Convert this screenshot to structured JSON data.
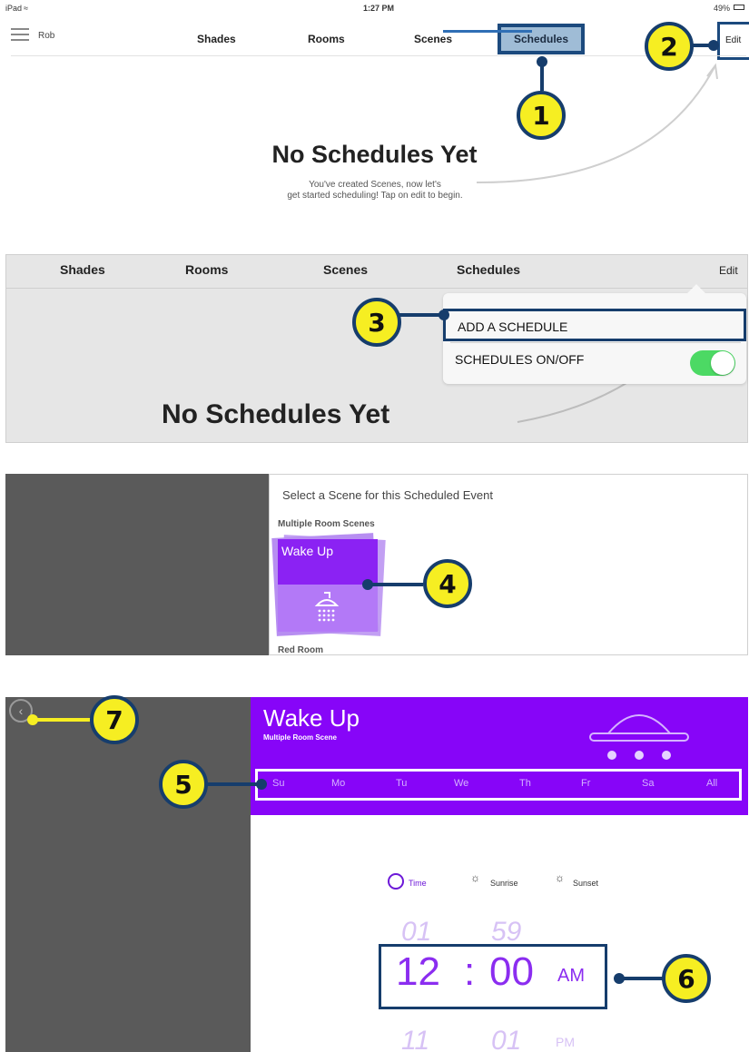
{
  "panel1": {
    "status": {
      "device": "iPad",
      "wifi_icon": "wifi-icon",
      "time": "1:27 PM",
      "battery": "49%"
    },
    "user_name": "Rob",
    "tabs": [
      "Shades",
      "Rooms",
      "Scenes",
      "Schedules"
    ],
    "edit_label": "Edit",
    "empty_title": "No Schedules Yet",
    "empty_subtitle_line1": "You've created Scenes, now let's",
    "empty_subtitle_line2": "get started scheduling! Tap on edit to begin."
  },
  "panel2": {
    "tabs": [
      "Shades",
      "Rooms",
      "Scenes",
      "Schedules"
    ],
    "edit_label": "Edit",
    "menu": {
      "add": "ADD A SCHEDULE",
      "toggle_label": "SCHEDULES ON/OFF",
      "toggle_on": true
    },
    "empty_title": "No Schedules Yet"
  },
  "panel3": {
    "title": "Select a Scene for this Scheduled Event",
    "group_label": "Multiple Room Scenes",
    "scene_name": "Wake Up",
    "scene_icon": "shower-icon",
    "next_group_label": "Red Room"
  },
  "panel4": {
    "scene_name": "Wake Up",
    "scene_type": "Multiple Room Scene",
    "days": [
      "Su",
      "Mo",
      "Tu",
      "We",
      "Th",
      "Fr",
      "Sa",
      "All"
    ],
    "time_display": "12:00 AM",
    "mode_tabs": [
      "Time",
      "Sunrise",
      "Sunset"
    ],
    "picker": {
      "prev_hour": "01",
      "prev_minute": "59",
      "hour": "12",
      "separator": ":",
      "minute": "00",
      "ampm": "AM",
      "next_hour": "11",
      "next_minute": "01",
      "next_ampm": "PM"
    }
  },
  "callouts": [
    "1",
    "2",
    "3",
    "4",
    "5",
    "6",
    "7"
  ],
  "colors": {
    "callout_fill": "#f6ee22",
    "callout_stroke": "#163d6c",
    "purple": "#8705f8",
    "toggle_green": "#4cd964"
  }
}
